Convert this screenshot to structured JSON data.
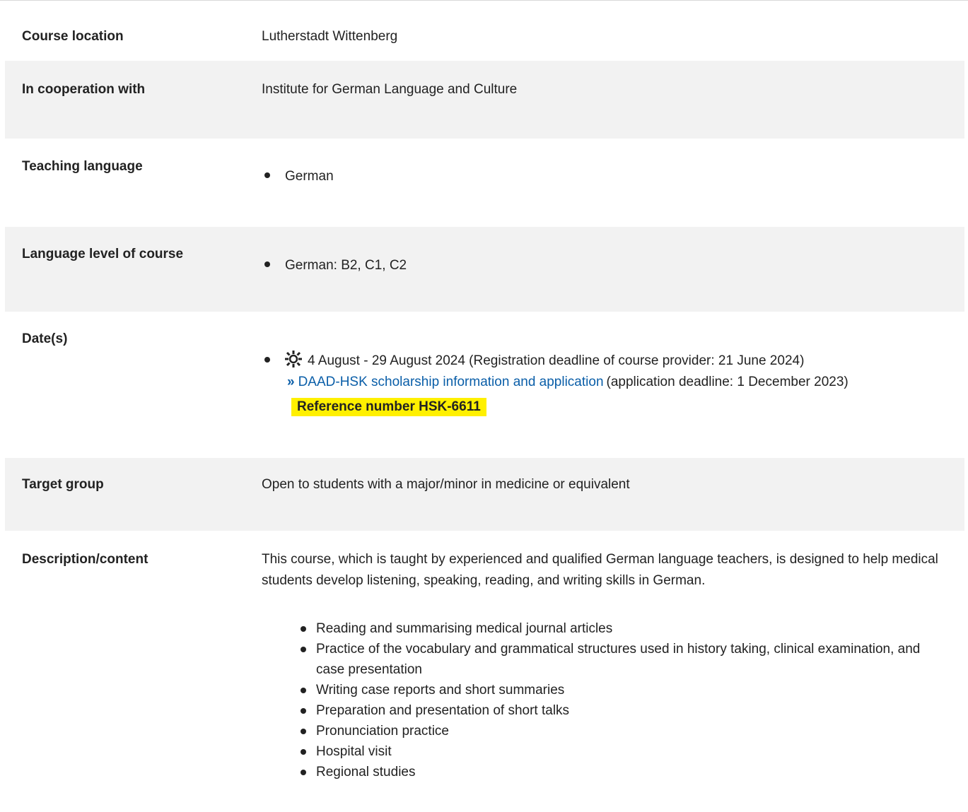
{
  "rows": {
    "course_location": {
      "label": "Course location",
      "value": "Lutherstadt Wittenberg"
    },
    "cooperation": {
      "label": "In cooperation with",
      "value": "Institute for German Language and Culture"
    },
    "teaching_language": {
      "label": "Teaching language",
      "items": [
        "German"
      ]
    },
    "language_level": {
      "label": "Language level of course",
      "items": [
        "German: B2, C1, C2"
      ]
    },
    "dates": {
      "label": "Date(s)",
      "season_icon": "sun-icon",
      "date_text": "4 August - 29 August 2024 (Registration deadline of course provider: 21 June 2024)",
      "link_icon": "double-chevron-right-icon",
      "link_text": "DAAD-HSK scholarship information and application",
      "link_suffix": "(application deadline: 1 December 2023)",
      "reference": "Reference number HSK-6611",
      "reference_highlight_color": "#fff000"
    },
    "target_group": {
      "label": "Target group",
      "value": "Open to students with a major/minor in medicine or equivalent"
    },
    "description": {
      "label": "Description/content",
      "intro": "This course, which is taught by experienced and qualified German language teachers, is designed to help medical students develop listening, speaking, reading, and writing skills in German.",
      "items": [
        "Reading and summarising medical journal articles",
        "Practice of the vocabulary and grammatical structures used in history taking, clinical examination, and case presentation",
        "Writing case reports and short summaries",
        "Preparation and presentation of short talks",
        "Pronunciation practice",
        "Hospital visit",
        "Regional studies"
      ]
    }
  },
  "colors": {
    "row_gray": "#f2f2f2",
    "link": "#0a5ea8",
    "text": "#222222"
  }
}
